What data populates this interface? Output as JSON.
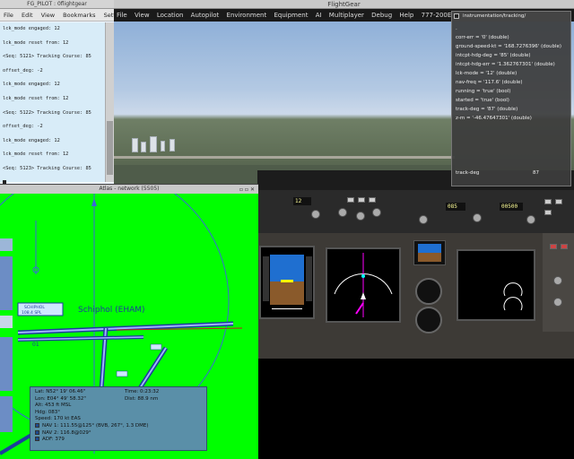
{
  "terminal": {
    "title": "FG_PILOT : 0flightgear",
    "menu": [
      "File",
      "Edit",
      "View",
      "Bookmarks",
      "Settings"
    ],
    "lines": [
      "lck_mode engaged: 12",
      "lck_mode reset from: 12",
      "<Seq: 5121> Tracking Course: 85",
      "offset_deg: -2",
      "lck_mode engaged: 12",
      "lck_mode reset from: 12",
      "<Seq: 5122> Tracking Course: 85",
      "offset_deg: -2",
      "lck_mode engaged: 12",
      "lck_mode reset from: 12",
      "<Seq: 5123> Tracking Course: 85"
    ]
  },
  "flightgear": {
    "title": "FlightGear",
    "menu": [
      "File",
      "View",
      "Location",
      "Autopilot",
      "Environment",
      "Equipment",
      "AI",
      "Multiplayer",
      "Debug",
      "Help",
      "777-200ER"
    ]
  },
  "property_browser": {
    "path": "instrumentation/tracking/",
    "items": [
      ".",
      "corr-err = '0' (double)",
      "ground-speed-kt = '168.7276396' (double)",
      "intcpt-hdg-deg = '85' (double)",
      "intcpt-hdg-err = '1.362767301' (double)",
      "lck-mode = '12' (double)",
      "nav-freq = '117.6' (double)",
      "running = 'true' (bool)",
      "started = 'true' (bool)",
      "track-deg = '87' (double)",
      "z-m = '-46.47647301' (double)"
    ],
    "selected_name": "track-deg",
    "selected_value": "87"
  },
  "atlas": {
    "title": "Atlas - network (5505)",
    "airport_label": "Schiphol (EHAM)",
    "nav_box_name": "SCHIPHOL",
    "nav_box_freq": "108.4 SPL",
    "runway_label": "01",
    "info": {
      "lat": "Lat: N52° 19' 06.46\"",
      "lon": "Lon: E04° 49' 58.32\"",
      "alt": "Alt: 453 ft MSL",
      "hdg": "Hdg: 083°",
      "speed": "Speed: 170 kt EAS",
      "time": "Time: 0:23:32",
      "dist": "Dist: 88.9 nm",
      "nav1": "NAV 1: 111.55@125° (BVB, 267°, 1.3 DME)",
      "nav2": "NAV 2: 116.8@029°",
      "adf": "ADF: 379"
    }
  },
  "colors": {
    "atlas_bg": "#00ff00",
    "terminal_bg": "#d8ecf8",
    "info_panel": "#5a8fa8"
  }
}
